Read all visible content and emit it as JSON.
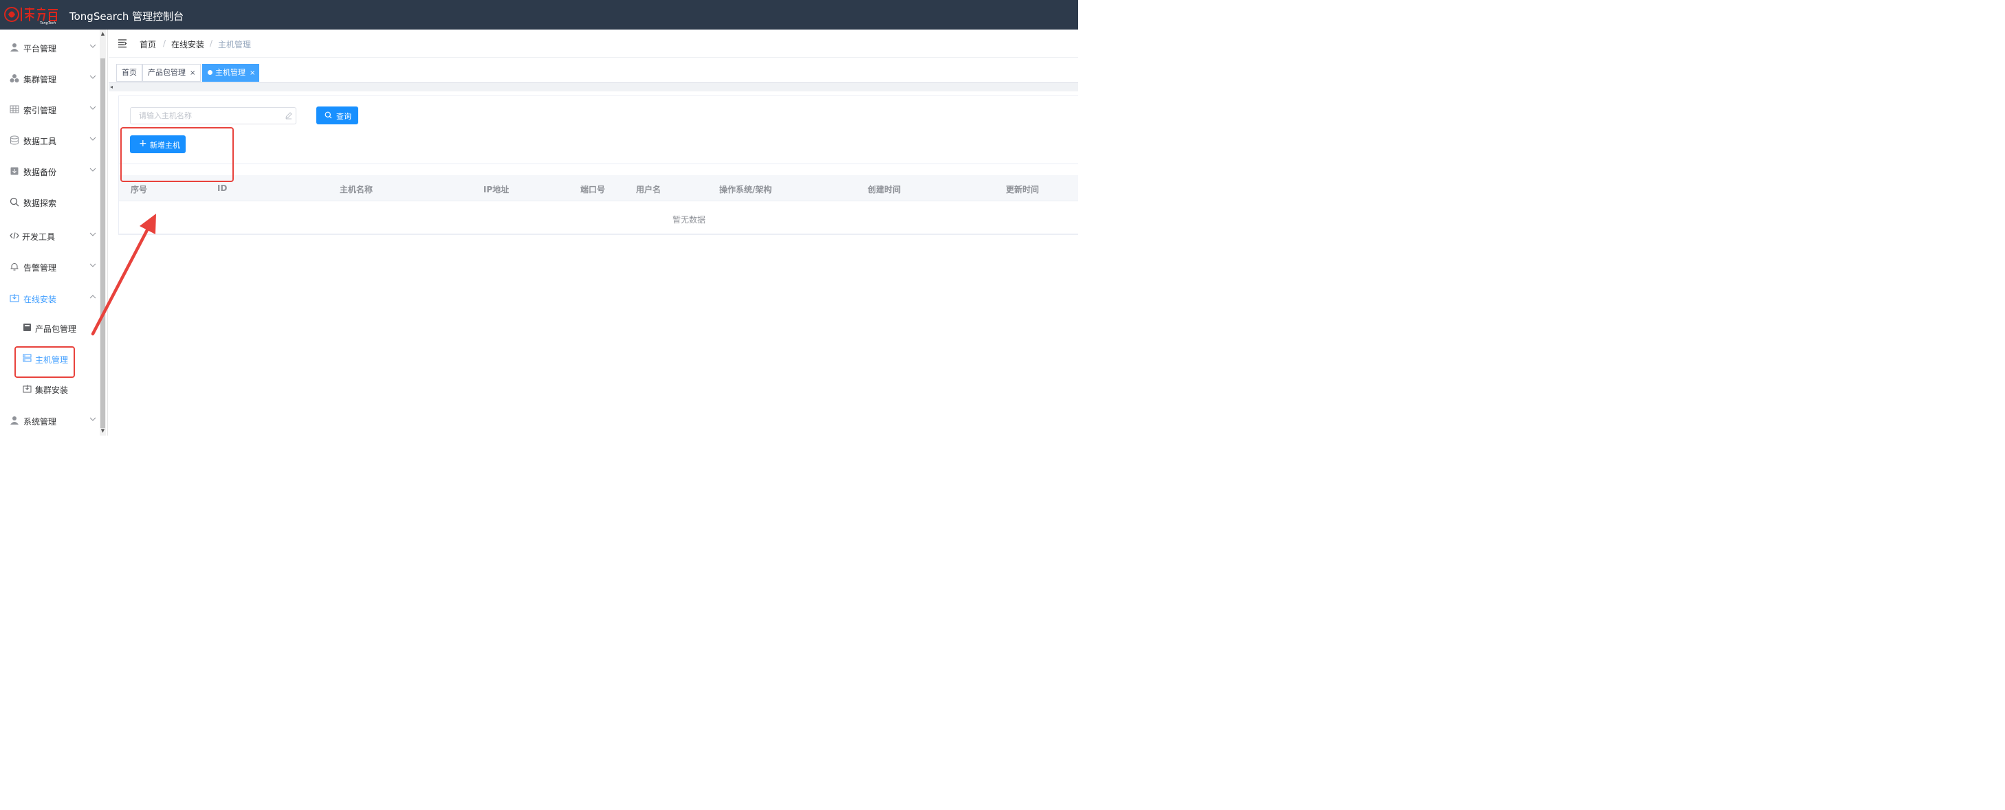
{
  "header": {
    "app_title": "TongSearch 管理控制台",
    "logo_text": "東方通 TongTech",
    "bg_color": "#2d3a4b"
  },
  "sidebar": {
    "items": [
      {
        "label": "平台管理",
        "icon": "user-icon"
      },
      {
        "label": "集群管理",
        "icon": "cluster-icon"
      },
      {
        "label": "索引管理",
        "icon": "table-icon"
      },
      {
        "label": "数据工具",
        "icon": "database-icon"
      },
      {
        "label": "数据备份",
        "icon": "archive-icon"
      },
      {
        "label": "数据探索",
        "icon": "search-icon"
      },
      {
        "label": "开发工具",
        "icon": "code-icon"
      },
      {
        "label": "告警管理",
        "icon": "bell-icon"
      },
      {
        "label": "在线安装",
        "icon": "install-icon",
        "expanded": true
      },
      {
        "label": "系统管理",
        "icon": "user-icon"
      }
    ],
    "sub_items": [
      {
        "label": "产品包管理",
        "icon": "package-icon"
      },
      {
        "label": "主机管理",
        "icon": "host-icon",
        "active": true
      },
      {
        "label": "集群安装",
        "icon": "download-box-icon"
      }
    ],
    "active_color": "#409eff"
  },
  "breadcrumb": [
    "首页",
    "在线安装",
    "主机管理"
  ],
  "tags": [
    {
      "label": "首页"
    },
    {
      "label": "产品包管理",
      "closable": true
    },
    {
      "label": "主机管理",
      "closable": true,
      "active": true
    }
  ],
  "search": {
    "placeholder": "请输入主机名称",
    "value": "",
    "query_label": "查询"
  },
  "toolbar": {
    "add_label": "新增主机"
  },
  "table": {
    "columns": [
      "序号",
      "ID",
      "主机名称",
      "IP地址",
      "端口号",
      "用户名",
      "操作系统/架构",
      "创建时间",
      "更新时间"
    ],
    "rows": [],
    "empty_text": "暂无数据"
  },
  "annotation_color": "#e8423c"
}
